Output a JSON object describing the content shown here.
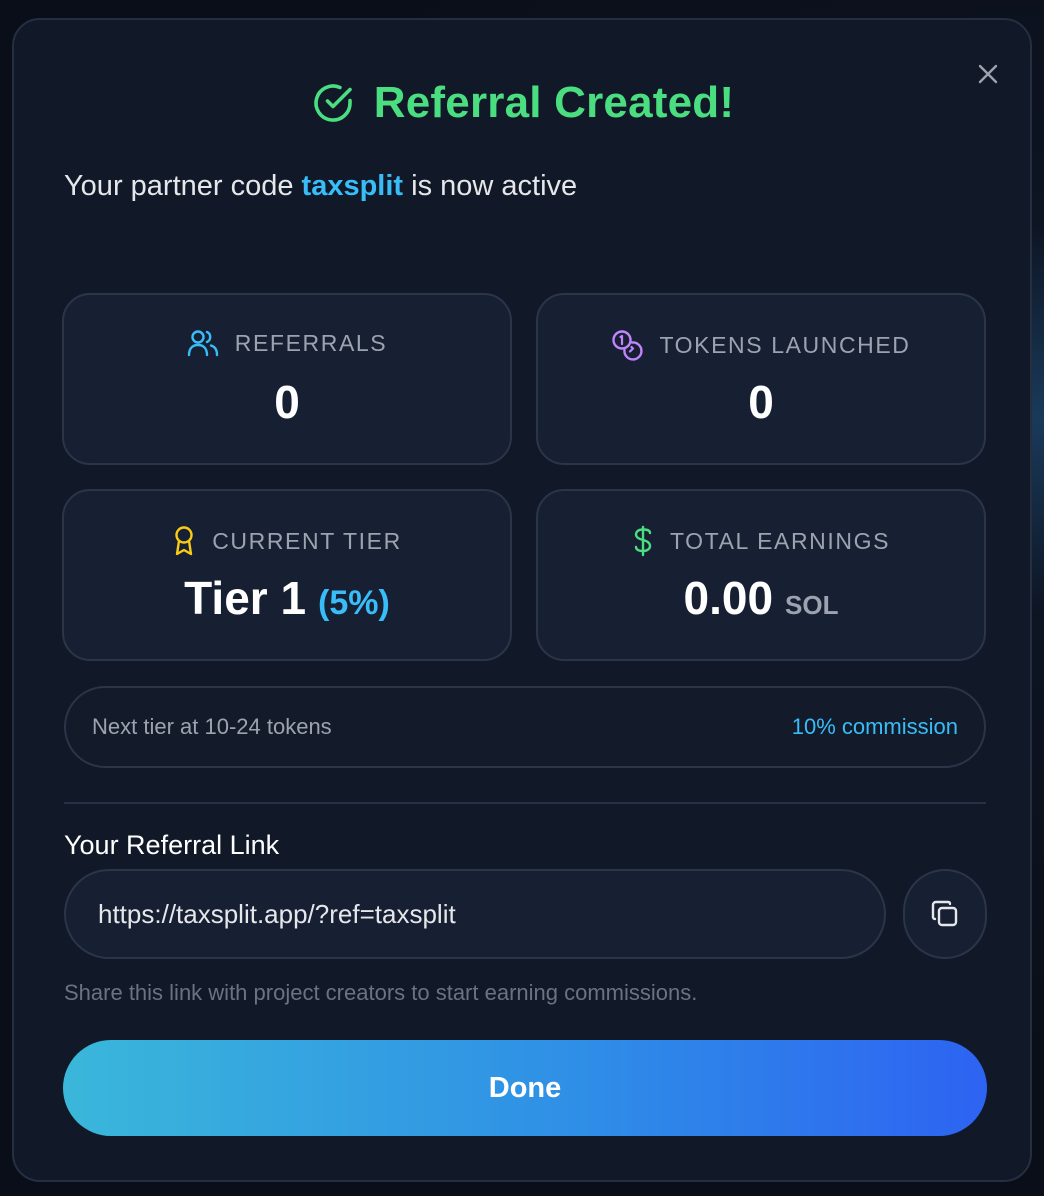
{
  "modal": {
    "title": "Referral Created!",
    "subtitle_prefix": "Your partner code",
    "partner_code": "taxsplit",
    "subtitle_suffix": "is now active"
  },
  "stats": {
    "referrals": {
      "label": "REFERRALS",
      "value": "0",
      "icon": "users-icon"
    },
    "tokens_launched": {
      "label": "TOKENS LAUNCHED",
      "value": "0",
      "icon": "coins-icon"
    },
    "current_tier": {
      "label": "CURRENT TIER",
      "value": "Tier 1",
      "percent": "(5%)",
      "icon": "award-icon"
    },
    "total_earnings": {
      "label": "TOTAL EARNINGS",
      "value": "0.00",
      "unit": "SOL",
      "icon": "dollar-icon"
    }
  },
  "tier_progress": {
    "next_tier": "Next tier at 10-24 tokens",
    "commission": "10% commission"
  },
  "referral_link": {
    "label": "Your Referral Link",
    "value": "https://taxsplit.app/?ref=taxsplit",
    "hint": "Share this link with project creators to start earning commissions."
  },
  "actions": {
    "done_label": "Done"
  },
  "colors": {
    "success": "#4ade80",
    "accent": "#38bdf8",
    "tier_icon": "#facc15",
    "tokens_icon": "#c084fc",
    "earnings_icon": "#4ade80",
    "button_gradient_start": "#3ab7da",
    "button_gradient_end": "#2d63f2"
  }
}
